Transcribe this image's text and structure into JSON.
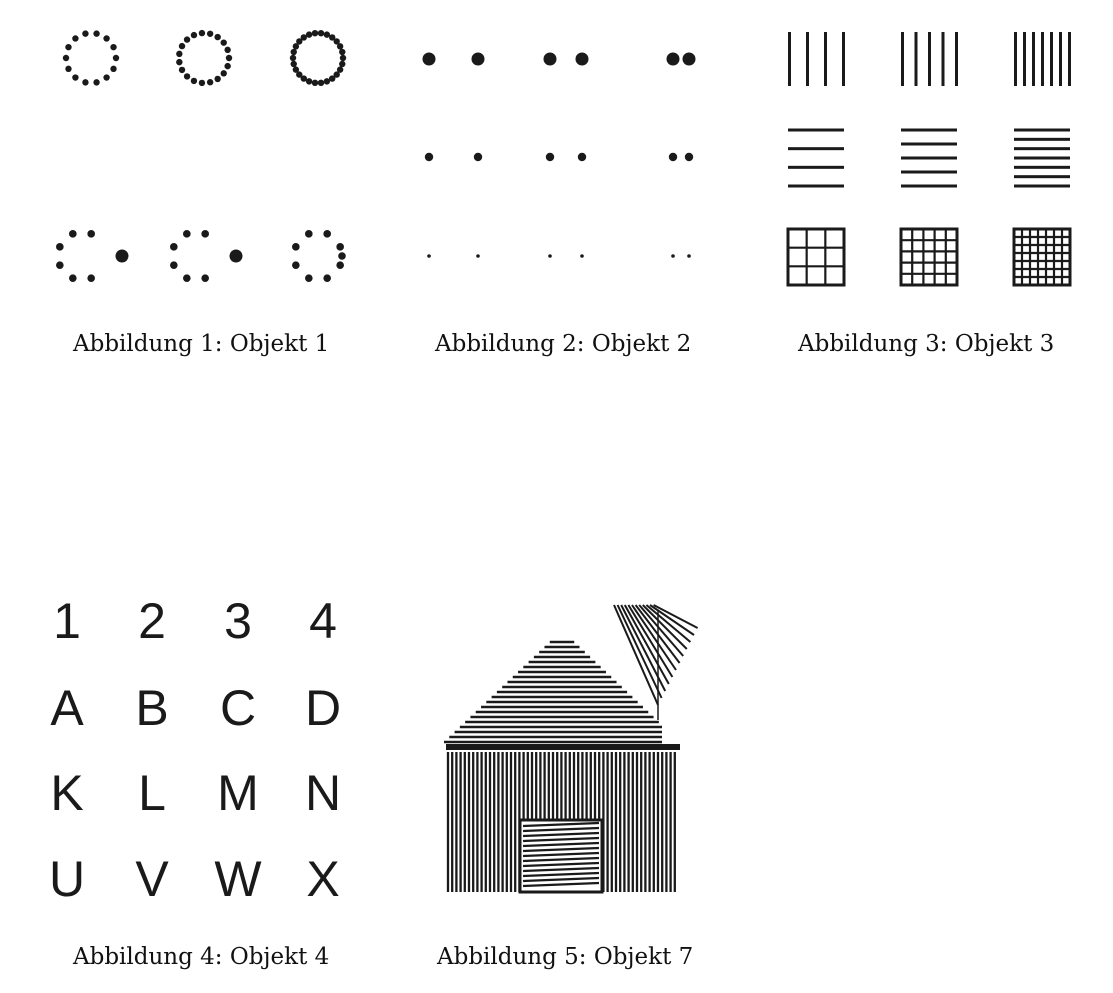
{
  "figures": [
    {
      "caption": "Abbildung 1: Objekt 1"
    },
    {
      "caption": "Abbildung 2: Objekt 2"
    },
    {
      "caption": "Abbildung 3: Objekt 3"
    },
    {
      "caption": "Abbildung 4: Objekt 4"
    },
    {
      "caption": "Abbildung 5: Objekt 7"
    }
  ],
  "letter_grid": {
    "rows": [
      [
        "1",
        "2",
        "3",
        "4"
      ],
      [
        "A",
        "B",
        "C",
        "D"
      ],
      [
        "K",
        "L",
        "M",
        "N"
      ],
      [
        "U",
        "V",
        "W",
        "X"
      ]
    ]
  },
  "colors": {
    "ink": "#1a1a1a",
    "background": "#ffffff"
  }
}
